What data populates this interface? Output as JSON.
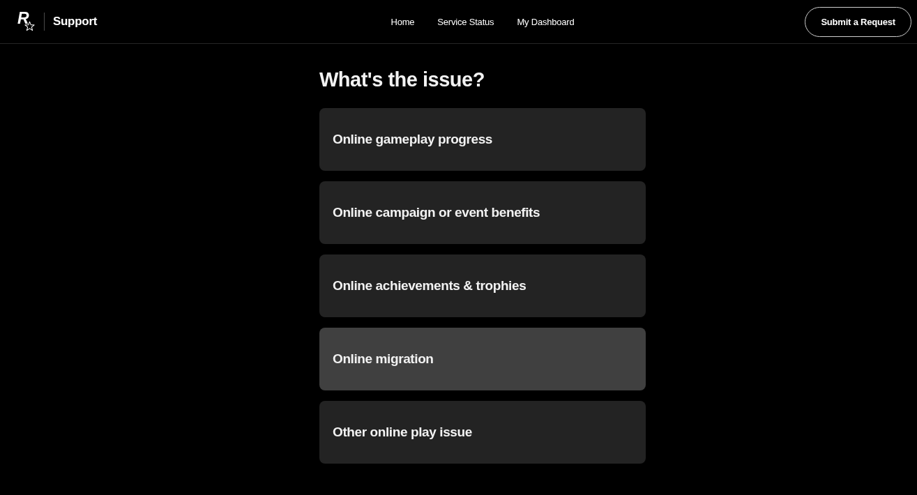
{
  "header": {
    "logo_letter": "R",
    "title": "Support",
    "nav": [
      {
        "label": "Home"
      },
      {
        "label": "Service Status"
      },
      {
        "label": "My Dashboard"
      }
    ],
    "action_button": "Submit a Request"
  },
  "main": {
    "heading": "What's the issue?",
    "options": [
      {
        "label": "Online gameplay progress",
        "selected": false
      },
      {
        "label": "Online campaign or event benefits",
        "selected": false
      },
      {
        "label": "Online achievements & trophies",
        "selected": false
      },
      {
        "label": "Online migration",
        "selected": true
      },
      {
        "label": "Other online play issue",
        "selected": false
      }
    ]
  }
}
